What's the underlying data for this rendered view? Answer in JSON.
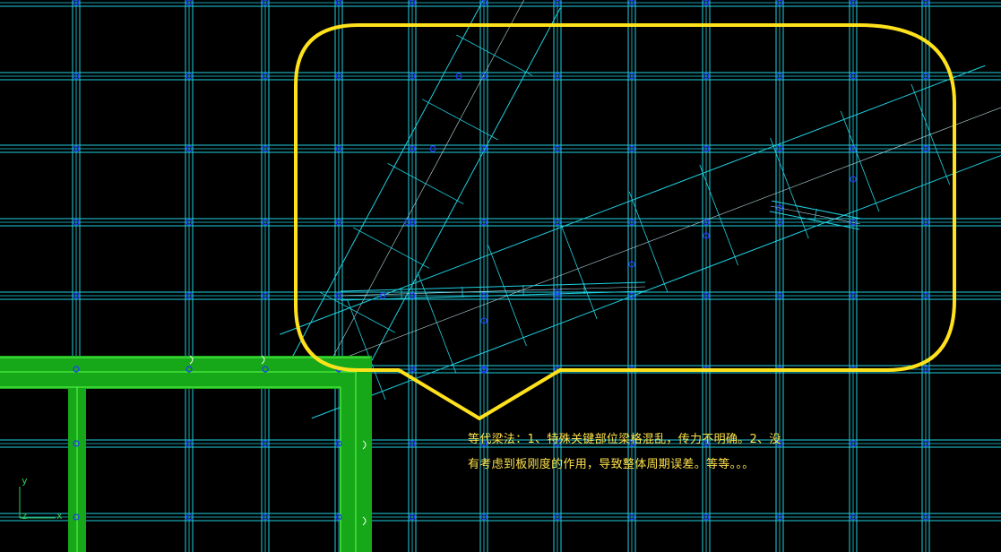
{
  "window": {
    "type": "structural-model-viewport",
    "background": "#000000"
  },
  "colors": {
    "grid": "#1fd0e0",
    "node": "#2238ff",
    "beam_fill": "#17a81a",
    "beam_edge": "#5cff4a",
    "callout": "#ffe21c",
    "note_text": "#ffe24a",
    "axis": "#33cc55"
  },
  "callout": {
    "line1": "等代梁法：1、特殊关键部位梁格混乱，传力不明确。2、没",
    "line2": "有考虑到板刚度的作用，导致整体周期误差。等等。。。"
  },
  "axis_triad": {
    "y": "y",
    "z": "z",
    "x": "x"
  }
}
